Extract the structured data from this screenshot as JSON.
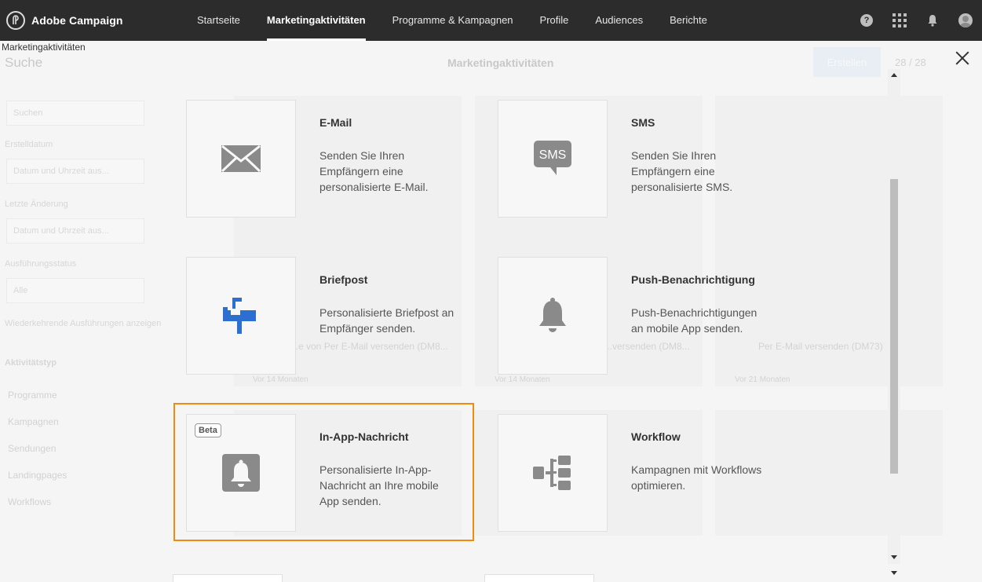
{
  "topbar": {
    "brand": "Adobe Campaign",
    "nav": [
      {
        "label": "Startseite",
        "active": false
      },
      {
        "label": "Marketingaktivitäten",
        "active": true
      },
      {
        "label": "Programme & Kampagnen",
        "active": false
      },
      {
        "label": "Profile",
        "active": false
      },
      {
        "label": "Audiences",
        "active": false
      },
      {
        "label": "Berichte",
        "active": false
      }
    ],
    "icons": [
      "help-icon",
      "apps-grid-icon",
      "notifications-bell-icon",
      "user-avatar-icon"
    ]
  },
  "background": {
    "breadcrumb": "Marketingaktivitäten",
    "search_title": "Suche",
    "center_title": "Marketingaktivitäten",
    "create_button": "Erstellen",
    "count": "28 / 28",
    "search_placeholder": "Suchen",
    "label_created": "Erstelldatum",
    "date_placeholder_1": "Datum und Uhrzeit aus...",
    "label_modified": "Letzte Änderung",
    "date_placeholder_2": "Datum und Uhrzeit aus...",
    "label_status": "Ausführungsstatus",
    "status_value": "Alle",
    "recurring_label": "Wiederkehrende Ausführungen anzeigen",
    "activity_type_label": "Aktivitätstyp",
    "activity_types": [
      "Programme",
      "Kampagnen",
      "Sendungen",
      "Landingpages",
      "Workflows"
    ],
    "tile_caption_1": "...e von Per E-Mail versenden (DM8...",
    "tile_caption_2": "...versenden (DM8...",
    "tile_caption_3": "Per E-Mail versenden (DM73)",
    "tile_meta_1": "Vor 14 Monaten",
    "tile_meta_2": "Vor 14 Monaten",
    "tile_meta_3": "Vor 21 Monaten",
    "colors": {
      "overlay": "#f5f5f5",
      "topbar": "#2c2c2c",
      "highlight": "#f28b0c",
      "mailbox_blue": "#2d6fd0"
    }
  },
  "modal": {
    "cards": [
      {
        "title": "E-Mail",
        "desc": "Senden Sie Ihren Empfängern eine personalisierte E-Mail.",
        "icon": "envelope-icon"
      },
      {
        "title": "SMS",
        "desc": "Senden Sie Ihren Empfängern eine personalisierte SMS.",
        "icon": "sms-bubble-icon",
        "icon_text": "SMS"
      },
      {
        "title": "Briefpost",
        "desc": "Personalisierte Briefpost an Empfänger senden.",
        "icon": "mailbox-icon"
      },
      {
        "title": "Push-Benachrichtigung",
        "desc": "Push-Benachrichtigungen an mobile App senden.",
        "icon": "bell-icon"
      },
      {
        "title": "In-App-Nachricht",
        "desc": "Personalisierte In-App-Nachricht an Ihre mobile App senden.",
        "icon": "in-app-bell-icon",
        "badge": "Beta",
        "highlighted": true
      },
      {
        "title": "Workflow",
        "desc": "Kampagnen mit Workflows optimieren.",
        "icon": "workflow-icon"
      }
    ]
  }
}
